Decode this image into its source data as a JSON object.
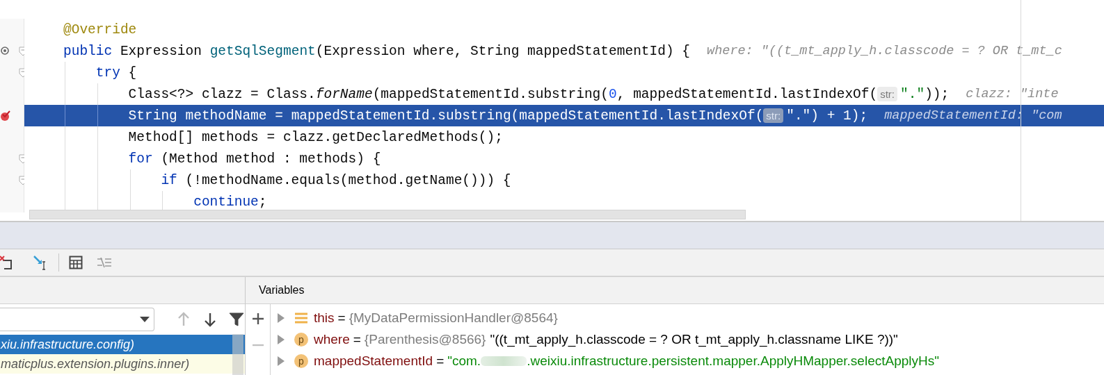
{
  "editor": {
    "lines": [
      {
        "current": false,
        "fold": false,
        "implements": false,
        "breakpoint": false,
        "tokens": [
          {
            "kind": "annotation",
            "text": "@Override"
          }
        ]
      },
      {
        "current": false,
        "fold": true,
        "implements": true,
        "breakpoint": false,
        "tokens": [
          {
            "kind": "keyword",
            "text": "public"
          },
          {
            "kind": "plain",
            "text": " Expression "
          },
          {
            "kind": "declaration",
            "text": "getSqlSegment"
          },
          {
            "kind": "plain",
            "text": "(Expression where, String mappedStatementId) {"
          }
        ],
        "hint": "where: \"((t_mt_apply_h.classcode = ? OR t_mt_c",
        "children": [
          {
            "current": false,
            "fold": true,
            "implements": false,
            "breakpoint": false,
            "tokens": [
              {
                "kind": "keyword",
                "text": "try"
              },
              {
                "kind": "plain",
                "text": " {"
              }
            ],
            "children": [
              {
                "current": false,
                "fold": false,
                "implements": false,
                "breakpoint": false,
                "tokens": [
                  {
                    "kind": "plain",
                    "text": "Class<?> clazz = Class."
                  },
                  {
                    "kind": "static",
                    "text": "forName"
                  },
                  {
                    "kind": "plain",
                    "text": "(mappedStatementId.substring("
                  },
                  {
                    "kind": "number",
                    "text": "0"
                  },
                  {
                    "kind": "plain",
                    "text": ", mappedStatementId.lastIndexOf("
                  },
                  {
                    "kind": "param",
                    "text": "str:"
                  },
                  {
                    "kind": "string",
                    "text": "\".\""
                  },
                  {
                    "kind": "plain",
                    "text": "));"
                  }
                ],
                "hint": "clazz: \"inte"
              },
              {
                "current": true,
                "fold": false,
                "implements": false,
                "breakpoint": true,
                "tokens": [
                  {
                    "kind": "plain",
                    "text": "String methodName = mappedStatementId.substring(mappedStatementId.lastIndexOf("
                  },
                  {
                    "kind": "param",
                    "text": "str:"
                  },
                  {
                    "kind": "string",
                    "text": "\".\""
                  },
                  {
                    "kind": "plain",
                    "text": ") + 1);"
                  }
                ],
                "hint": "mappedStatementId: \"com"
              },
              {
                "current": false,
                "fold": false,
                "implements": false,
                "breakpoint": false,
                "tokens": [
                  {
                    "kind": "plain",
                    "text": "Method[] methods = clazz.getDeclaredMethods();"
                  }
                ]
              },
              {
                "current": false,
                "fold": true,
                "implements": false,
                "breakpoint": false,
                "tokens": [
                  {
                    "kind": "keyword",
                    "text": "for"
                  },
                  {
                    "kind": "plain",
                    "text": " (Method method : methods) {"
                  }
                ],
                "children": [
                  {
                    "current": false,
                    "fold": true,
                    "implements": false,
                    "breakpoint": false,
                    "tokens": [
                      {
                        "kind": "keyword",
                        "text": "if"
                      },
                      {
                        "kind": "plain",
                        "text": " (!methodName.equals(method.getName())) {"
                      }
                    ],
                    "children": [
                      {
                        "current": false,
                        "fold": false,
                        "implements": false,
                        "breakpoint": false,
                        "tokens": [
                          {
                            "kind": "keyword",
                            "text": "continue"
                          },
                          {
                            "kind": "plain",
                            "text": ";"
                          }
                        ]
                      }
                    ]
                  }
                ]
              }
            ]
          }
        ]
      }
    ]
  },
  "frames": {
    "items": [
      {
        "text": "xiu.infrastructure.config)",
        "selected": true
      },
      {
        "text": "maticplus.extension.plugins.inner)",
        "selected": false
      }
    ],
    "nav": [
      {
        "kind": "up",
        "disabled": true
      },
      {
        "kind": "down",
        "disabled": false
      },
      {
        "kind": "filter",
        "disabled": false
      }
    ]
  },
  "variables": {
    "title": "Variables",
    "items": [
      {
        "kind": "field",
        "name": "this",
        "separator": "=",
        "value": [
          {
            "kind": "ref",
            "text": "{MyDataPermissionHandler@8564}"
          }
        ]
      },
      {
        "kind": "parameter",
        "badge": "p",
        "name": "where",
        "separator": "=",
        "value": [
          {
            "kind": "ref",
            "text": "{Parenthesis@8566}"
          },
          {
            "kind": "text",
            "text": "\"((t_mt_apply_h.classcode = ? OR t_mt_apply_h.classname LIKE ?))\""
          }
        ]
      },
      {
        "kind": "parameter",
        "badge": "p",
        "name": "mappedStatementId",
        "separator": "=",
        "value": [
          {
            "kind": "string",
            "text": "\"com."
          },
          {
            "kind": "redacted"
          },
          {
            "kind": "string",
            "text": ".weixiu.infrastructure.persistent.mapper.ApplyHMapper.selectApplyHs\""
          }
        ]
      }
    ]
  }
}
